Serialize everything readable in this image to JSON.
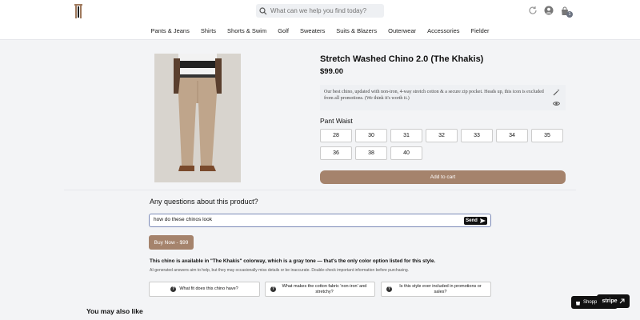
{
  "header": {
    "search_placeholder": "What can we help you find today?",
    "cart_count": "1"
  },
  "nav": {
    "items": [
      "Pants & Jeans",
      "Shirts",
      "Shorts & Swim",
      "Golf",
      "Sweaters",
      "Suits & Blazers",
      "Outerwear",
      "Accessories",
      "Fielder"
    ]
  },
  "product": {
    "title": "Stretch Washed Chino 2.0 (The Khakis)",
    "price": "$99.00",
    "description": "Our best chino, updated with non-iron, 4-way stretch cotton & a secure zip pocket. Heads up, this icon is excluded from all promotions. (We think it's worth it.)",
    "waist_label": "Pant Waist",
    "sizes": [
      "28",
      "30",
      "31",
      "32",
      "33",
      "34",
      "35",
      "36",
      "38",
      "40"
    ],
    "add_to_cart_label": "Add to cart"
  },
  "qa": {
    "heading": "Any questions about this product?",
    "input_value": "how do these chinos look ",
    "send_label": "Send",
    "buy_now_label": "Buy Now - $99",
    "answer": "This chino is available in \"The Khakis\" colorway, which is a gray tone — that's the only color option listed for this style.",
    "disclaimer": "AI-generated answers aim to help, but they may occasionally miss details or be inaccurate. Double-check important information before purchasing.",
    "suggestions": [
      "What fit does this chino have?",
      "What makes the cotton fabric 'non-iron' and stretchy?",
      "Is this style ever included in promotions or sales?"
    ]
  },
  "also_like_heading": "You may also like",
  "floating": {
    "shop_label": "Shopp",
    "stripe_label": "stripe"
  },
  "colors": {
    "accent": "#a5836c",
    "background": "#f3f4f6",
    "send_button": "#111111"
  }
}
